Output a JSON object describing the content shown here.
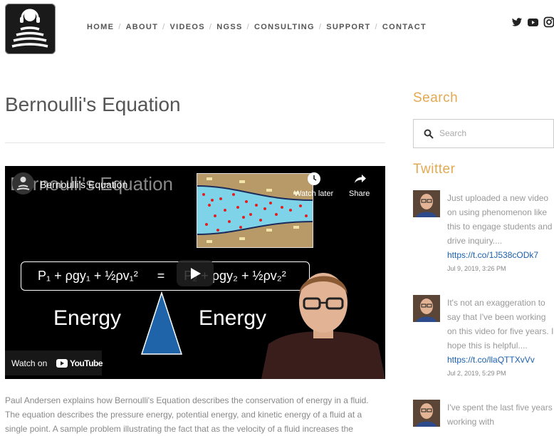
{
  "nav": {
    "items": [
      {
        "label": "HOME"
      },
      {
        "label": "ABOUT"
      },
      {
        "label": "VIDEOS"
      },
      {
        "label": "NGSS"
      },
      {
        "label": "CONSULTING"
      },
      {
        "label": "SUPPORT"
      },
      {
        "label": "CONTACT"
      }
    ]
  },
  "social": {
    "icons": [
      "twitter-icon",
      "youtube-icon",
      "instagram-icon"
    ]
  },
  "page": {
    "title": "Bernoulli's Equation"
  },
  "video": {
    "title": "Bernoulli's Equation",
    "watch_later_label": "Watch later",
    "share_label": "Share",
    "equation_left": "P₁ + ρgy₁ + ½ρv₁²",
    "equals": "=",
    "equation_right": "P₂ + ρgy₂ + ½ρv₂²",
    "energy_left": "Energy",
    "energy_right": "Energy",
    "watch_on_label": "Watch on",
    "youtube_label": "YouTube"
  },
  "description": "Paul Andersen explains how Bernoulli's Equation describes the conservation of energy in a fluid. The equation describes the pressure energy, potential energy, and kinetic energy of a fluid at a single point. A sample problem illustrating the fact that as the velocity of a fluid increases the",
  "sidebar": {
    "search_heading": "Search",
    "search_placeholder": "Search",
    "twitter_heading": "Twitter",
    "tweets": [
      {
        "text": "Just uploaded a new video on using phenomenon like this to engage students and drive inquiry....",
        "link": "https://t.co/1J538cODk7",
        "time": "Jul 9, 2019, 3:26 PM"
      },
      {
        "text": "It's not an exaggeration to say that I've been working on this video for five years. I hope this is helpful....",
        "link": "https://t.co/llaQTTXvVv",
        "time": "Jul 2, 2019, 5:29 PM"
      },
      {
        "text": "I've spent the last five years working with",
        "link": "",
        "time": ""
      }
    ]
  },
  "colors": {
    "accent": "#e3a951",
    "link": "#1a5fb0"
  }
}
